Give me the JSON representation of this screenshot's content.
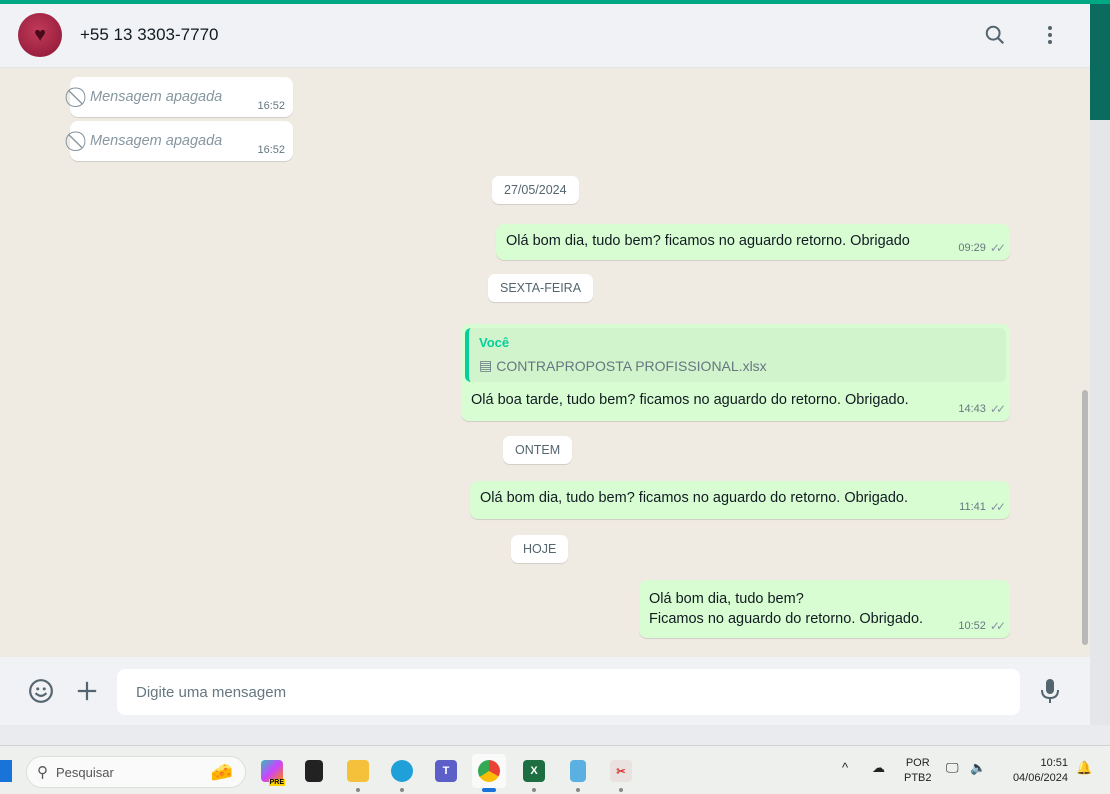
{
  "header": {
    "contact": "+55 13 3303-7770",
    "icons": [
      "search-icon",
      "menu-icon"
    ]
  },
  "messages": [
    {
      "type": "deleted",
      "text": "Mensagem apagada",
      "time": "16:52"
    },
    {
      "type": "deleted",
      "text": "Mensagem apagada",
      "time": "16:52"
    },
    {
      "type": "date",
      "text": "27/05/2024"
    },
    {
      "type": "out",
      "text": "Olá bom dia, tudo bem? ficamos no aguardo retorno. Obrigado",
      "time": "09:29"
    },
    {
      "type": "date",
      "text": "SEXTA-FEIRA"
    },
    {
      "type": "out",
      "quote_author": "Você",
      "quote_file": "CONTRAPROPOSTA PROFISSIONAL.xlsx",
      "text": "Olá boa tarde, tudo bem? ficamos no aguardo do retorno. Obrigado.",
      "time": "14:43"
    },
    {
      "type": "date",
      "text": "ONTEM"
    },
    {
      "type": "out",
      "text": "Olá bom dia, tudo bem? ficamos no aguardo do retorno. Obrigado.",
      "time": "11:41"
    },
    {
      "type": "date",
      "text": "HOJE"
    },
    {
      "type": "out",
      "line1": "Olá bom dia, tudo bem?",
      "line2": "Ficamos no aguardo do retorno. Obrigado.",
      "time": "10:52"
    }
  ],
  "footer": {
    "placeholder": "Digite uma mensagem"
  },
  "taskbar": {
    "search": "Pesquisar",
    "lang1": "POR",
    "lang2": "PTB2",
    "time": "10:51",
    "date": "04/06/2024",
    "copilot_badge": "PRE"
  }
}
